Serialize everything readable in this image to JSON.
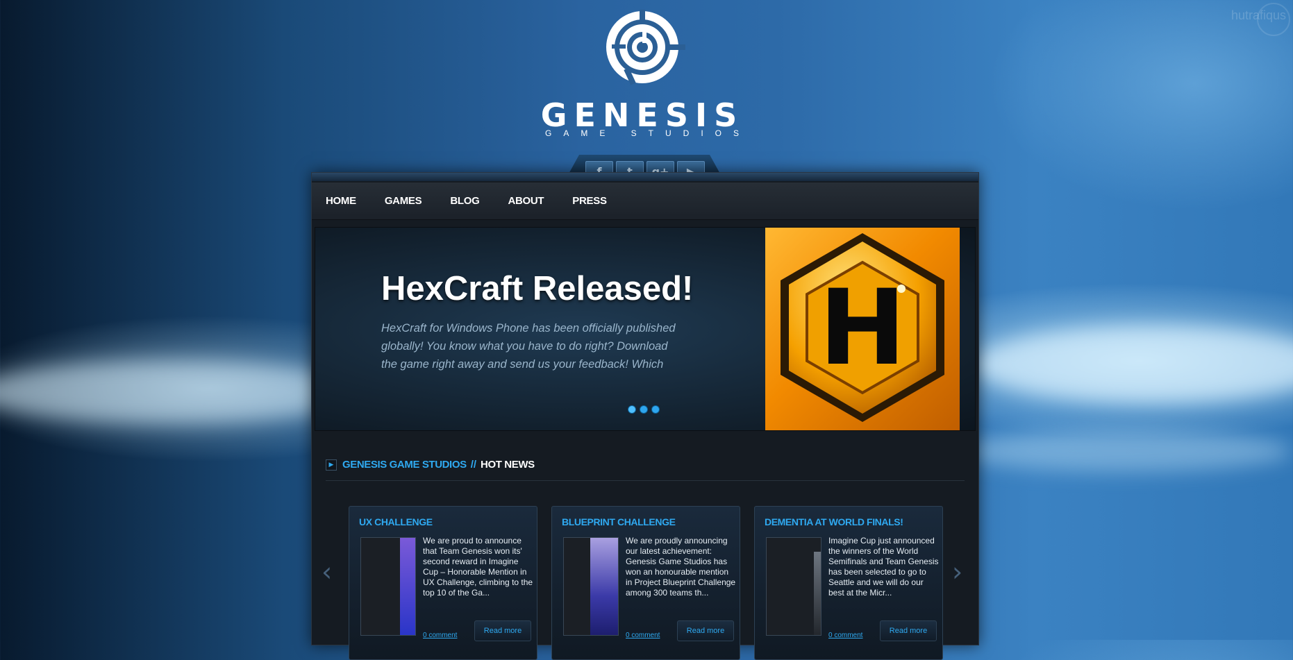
{
  "brand": {
    "title": "GENESIS",
    "subtitle": "GAME STUDIOS"
  },
  "social": [
    {
      "icon": "facebook-icon",
      "glyph": "f"
    },
    {
      "icon": "twitter-icon",
      "glyph": "t"
    },
    {
      "icon": "google-plus-icon",
      "glyph": "g+"
    },
    {
      "icon": "youtube-icon",
      "glyph": "▶"
    }
  ],
  "nav": {
    "home": "HOME",
    "games": "GAMES",
    "blog": "BLOG",
    "about": "ABOUT",
    "press": "PRESS"
  },
  "slider": {
    "title": "HexCraft Released!",
    "description": "HexCraft for Windows Phone has been officially published globally! You know what you have to do right? Download the game right away and send us your feedback! Which",
    "image_letter": "H",
    "dots": 3,
    "active_dot": 1
  },
  "news": {
    "brand": "GENESIS GAME STUDIOS",
    "separator": "//",
    "heading": "HOT NEWS",
    "cards": [
      {
        "title": "UX CHALLENGE",
        "text": "We are proud to announce that Team Genesis won its' second reward in Imagine Cup – Honorable Mention in UX Challenge, climbing to the top 10 of the Ga...",
        "comment": "0 comment",
        "read_more": "Read more"
      },
      {
        "title": "BLUEPRINT CHALLENGE",
        "text": "We are proudly announcing our latest achievement: Genesis Game Studios has won an honourable mention in Project Blueprint Challenge among 300 teams th...",
        "comment": "0 comment",
        "read_more": "Read more"
      },
      {
        "title": "DEMENTIA AT WORLD FINALS!",
        "text": "Imagine Cup just announced the winners of the World Semifinals and Team Genesis has been selected to go to Seattle and we will do our best at the Micr...",
        "comment": "0 comment",
        "read_more": "Read more"
      }
    ],
    "prev_icon": "‹",
    "next_icon": "›"
  },
  "watermark": "hutrafiqus",
  "colors": {
    "accent": "#2fa9f0",
    "slide_gold": "#f28a00",
    "panel": "#151b22"
  }
}
